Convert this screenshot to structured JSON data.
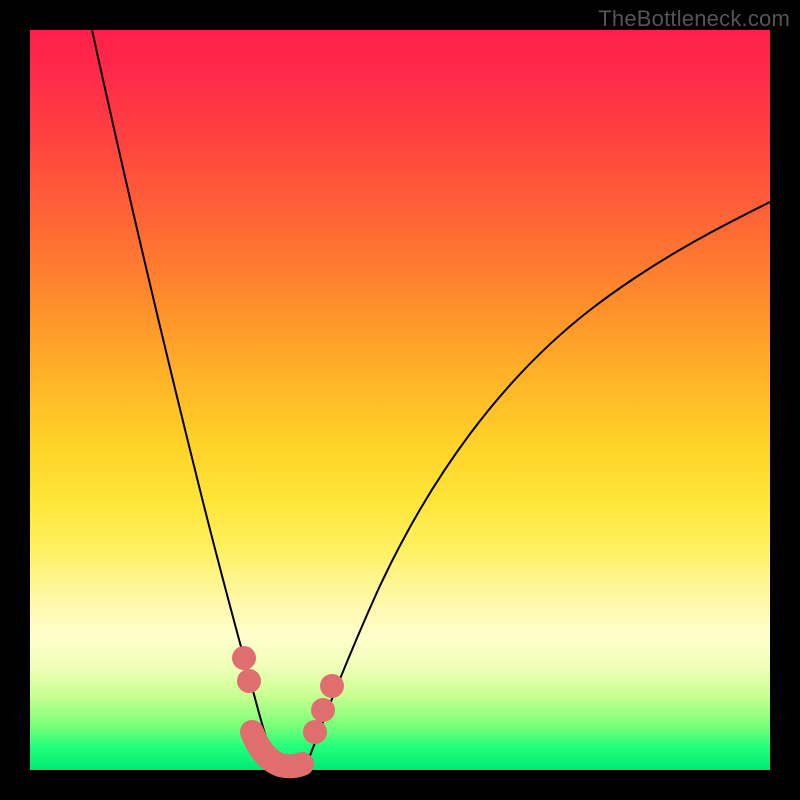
{
  "watermark": "TheBottleneck.com",
  "colors": {
    "frame": "#000000",
    "gradient_top": "#ff1f4a",
    "gradient_bottom": "#00e874",
    "curve": "#000000",
    "marker": "#e06e6e"
  },
  "chart_data": {
    "type": "line",
    "title": "",
    "xlabel": "",
    "ylabel": "",
    "xlim": [
      0,
      100
    ],
    "ylim": [
      0,
      100
    ],
    "notes": "Axes and ticks are not shown; values are estimated from geometry. Two curves descend into a common minimum near x≈33. Left curve starts at top-left, right curve rises toward the right edge. Pink markers and a short rounded segment sit near the trough.",
    "series": [
      {
        "name": "left-curve",
        "x": [
          8,
          10,
          13,
          16,
          19,
          22,
          25,
          27,
          29,
          30,
          31,
          32,
          33
        ],
        "y": [
          100,
          90,
          78,
          66,
          54,
          42,
          30,
          22,
          14,
          9,
          5,
          2,
          0
        ]
      },
      {
        "name": "right-curve",
        "x": [
          37,
          39,
          42,
          46,
          52,
          60,
          70,
          82,
          94,
          100
        ],
        "y": [
          0,
          4,
          10,
          18,
          28,
          40,
          52,
          63,
          72,
          77
        ]
      }
    ],
    "markers": [
      {
        "series": "left-curve",
        "x": 29.0,
        "y": 16
      },
      {
        "series": "left-curve",
        "x": 29.6,
        "y": 13
      },
      {
        "series": "right-curve",
        "x": 38.0,
        "y": 5
      },
      {
        "series": "right-curve",
        "x": 38.8,
        "y": 8
      },
      {
        "series": "right-curve",
        "x": 39.8,
        "y": 11
      }
    ],
    "trough_segment": {
      "x": [
        30,
        31,
        32,
        33,
        34,
        35,
        36,
        37
      ],
      "y": [
        5,
        2,
        0.5,
        0,
        0,
        0.3,
        0.8,
        1.6
      ]
    }
  }
}
